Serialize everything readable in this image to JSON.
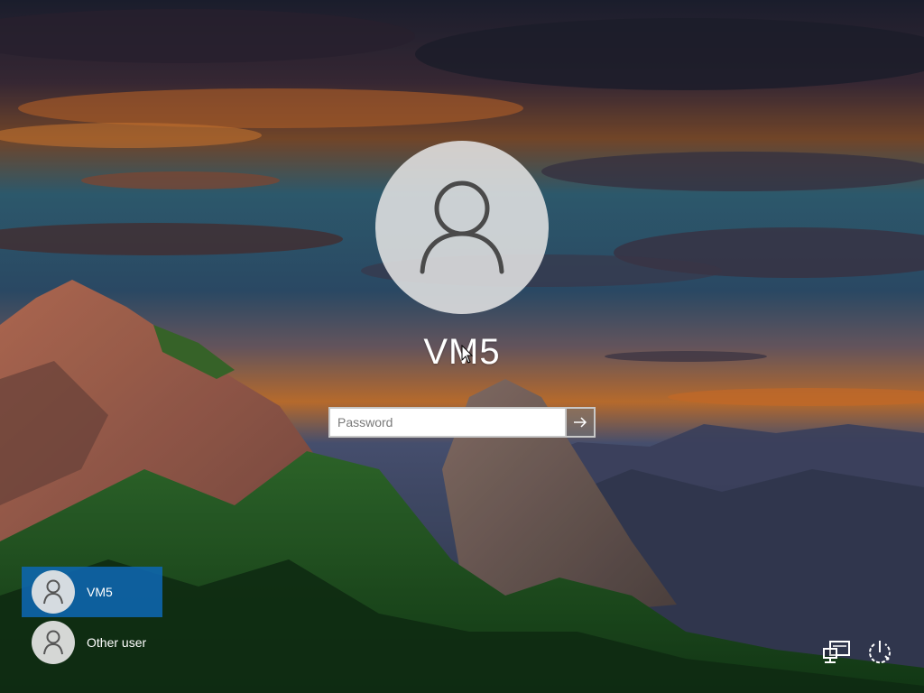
{
  "lock_screen": {
    "user_name": "VM5",
    "password": {
      "placeholder": "Password",
      "value": ""
    }
  },
  "user_list": [
    {
      "name": "VM5",
      "selected": true
    },
    {
      "name": "Other user",
      "selected": false
    }
  ],
  "icons": {
    "avatar": "person-icon",
    "submit": "arrow-right-icon",
    "network": "network-icon",
    "power": "power-icon"
  }
}
